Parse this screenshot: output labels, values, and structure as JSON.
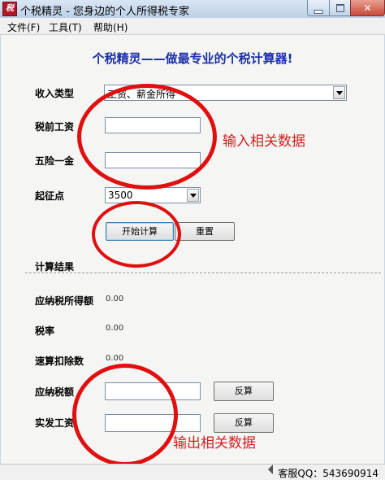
{
  "window": {
    "icon_char": "税",
    "title": "个税精灵 - 您身边的个人所得税专家"
  },
  "menu": {
    "items": [
      {
        "label": "文件(F)"
      },
      {
        "label": "工具(T)"
      },
      {
        "label": "帮助(H)"
      }
    ]
  },
  "headline": "个税精灵——做最专业的个税计算器!",
  "form": {
    "income_type": {
      "label": "收入类型",
      "value": "工资、薪金所得"
    },
    "pre_tax_salary": {
      "label": "税前工资",
      "value": ""
    },
    "insurance": {
      "label": "五险一金",
      "value": ""
    },
    "threshold": {
      "label": "起征点",
      "value": "3500"
    },
    "calculate_button": "开始计算",
    "reset_button": "重置"
  },
  "results": {
    "section_label": "计算结果",
    "taxable_income": {
      "label": "应纳税所得额",
      "value": "0.00"
    },
    "tax_rate": {
      "label": "税率",
      "value": "0.00"
    },
    "quick_deduction": {
      "label": "速算扣除数",
      "value": "0.00"
    },
    "tax_payable": {
      "label": "应纳税额",
      "value": "",
      "button": "反算"
    },
    "net_salary": {
      "label": "实发工资",
      "value": "",
      "button": "反算"
    }
  },
  "annotations": {
    "input_note": "输入相关数据",
    "output_note": "输出相关数据"
  },
  "status": {
    "support_qq": "客服QQ：543690914"
  },
  "colors": {
    "headline": "#1a2fa8",
    "annotation_red": "#e01010"
  }
}
